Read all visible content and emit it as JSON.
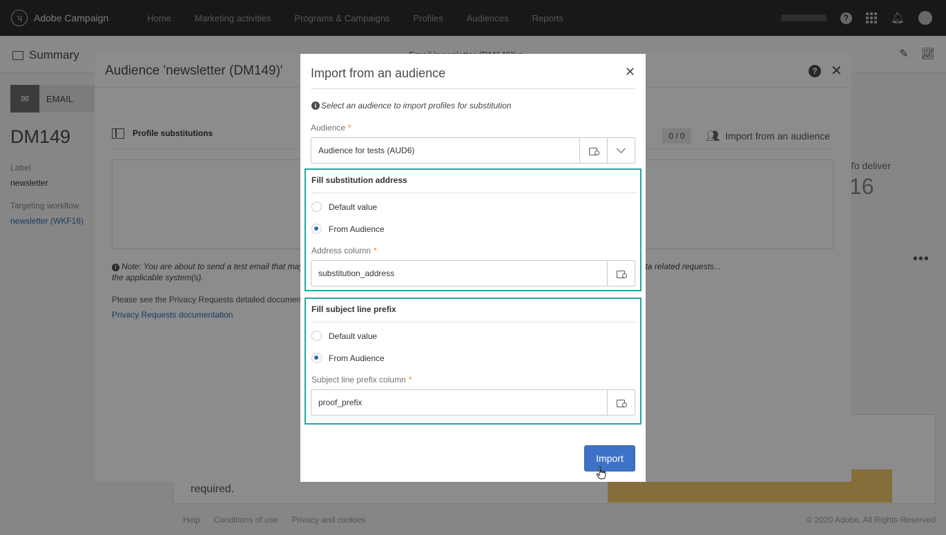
{
  "topbar": {
    "app_name": "Adobe Campaign",
    "nav": [
      "Home",
      "Marketing activities",
      "Programs & Campaigns",
      "Profiles",
      "Audiences",
      "Reports"
    ]
  },
  "page": {
    "summary_title": "Summary",
    "header_center": "Email 'newsletter (DM149)' ▾",
    "email_tab": "EMAIL",
    "dm_title": "DM149",
    "label_caption": "Label",
    "label_value": "newsletter",
    "workflow_caption": "Targeting workflow",
    "workflow_link": "newsletter (WKF16)",
    "to_deliver_label": "To deliver",
    "to_deliver_value": "16",
    "bottom_text": "required.",
    "footer": [
      "Help",
      "Conditions of use",
      "Privacy and cookies"
    ],
    "copyright": "© 2020 Adobe. All Rights Reserved"
  },
  "audience_dialog": {
    "title": "Audience 'newsletter (DM149)'",
    "section_label": "Profile substitutions",
    "count": "0 / 0",
    "import_label": "Import from an audience",
    "note": "Note: You are about to send a test email that may include personal data ... Standard. You must execute data related requests ... the applicable system(s).",
    "note_left": "Note: You are about to send a test email that may i",
    "note_right": "n Standard. You must execute data related requests...",
    "note_line2": "the applicable system(s).",
    "privacy_see": "Please see the Privacy Requests detailed documenta",
    "privacy_link": "Privacy Requests documentation"
  },
  "import_modal": {
    "title": "Import from an audience",
    "info": "Select an audience to import profiles for substitution",
    "audience_label": "Audience",
    "audience_value": "Audience for tests (AUD6)",
    "address_section": {
      "title": "Fill substitution address",
      "option_default": "Default value",
      "option_audience": "From Audience",
      "selected": "From Audience",
      "column_label": "Address column",
      "column_value": "substitution_address"
    },
    "prefix_section": {
      "title": "Fill subject line prefix",
      "option_default": "Default value",
      "option_audience": "From Audience",
      "selected": "From Audience",
      "column_label": "Subject line prefix column",
      "column_value": "proof_prefix"
    },
    "import_button": "Import"
  },
  "colors": {
    "topbar": "#2c2c2c",
    "accent_blue": "#3d73c6",
    "highlight_teal": "#1fa89b",
    "required_orange": "#e68619"
  },
  "icons": [
    "adobe-logo-icon",
    "help-icon",
    "apps-grid-icon",
    "bell-icon",
    "avatar",
    "summary-icon",
    "pencil-icon",
    "chart-icon",
    "envelope-icon",
    "close-icon",
    "info-icon",
    "picker-icon",
    "chevron-down-icon",
    "import-people-icon",
    "hand-cursor-icon"
  ]
}
